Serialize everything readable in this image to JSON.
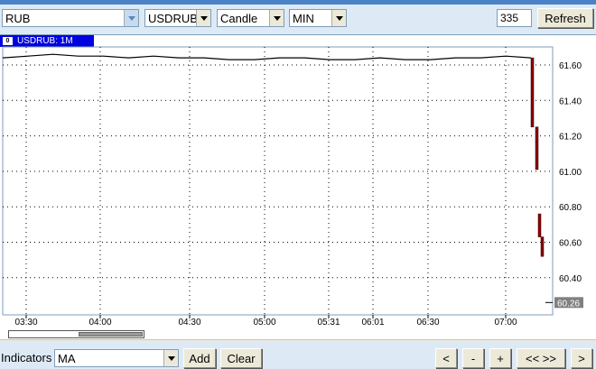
{
  "toolbar": {
    "currency": "RUB",
    "symbol": "USDRUB",
    "chart_type": "Candle",
    "period": "MIN",
    "bar_count": "335",
    "refresh_label": "Refresh"
  },
  "chart_tab": {
    "close_glyph": "0",
    "title": "USDRUB: 1M"
  },
  "colors": {
    "candle_down": "#8b0000",
    "tab_bg": "#0000e0",
    "price_tag": "#808080"
  },
  "chart_data": {
    "type": "line",
    "ylim": [
      60.26,
      61.7
    ],
    "y_ticks": [
      "61.60",
      "61.40",
      "61.20",
      "61.00",
      "60.80",
      "60.60",
      "60.40"
    ],
    "x_ticks": [
      "03:30",
      "04:00",
      "04:30",
      "05:00",
      "05:31",
      "06:01",
      "06:30",
      "07:00"
    ],
    "current_price": "60.26",
    "grid": true,
    "series": [
      {
        "points": [
          61.64,
          61.65,
          61.66,
          61.65,
          61.65,
          61.64,
          61.65,
          61.64,
          61.64,
          61.63,
          61.63,
          61.64,
          61.64,
          61.63,
          61.63,
          61.64,
          61.63,
          61.63,
          61.64,
          61.64,
          61.65,
          61.64
        ]
      }
    ],
    "candles": [
      {
        "open": 61.64,
        "close": 61.25
      },
      {
        "open": 61.25,
        "close": 61.01
      },
      {
        "open": 60.76,
        "close": 60.63
      },
      {
        "open": 60.63,
        "close": 60.52
      }
    ]
  },
  "bottom": {
    "indicators_label": "Indicators",
    "indicator": "MA",
    "add_label": "Add",
    "clear_label": "Clear",
    "nav": [
      "<",
      "-",
      "+",
      "<< >>",
      ">"
    ]
  }
}
